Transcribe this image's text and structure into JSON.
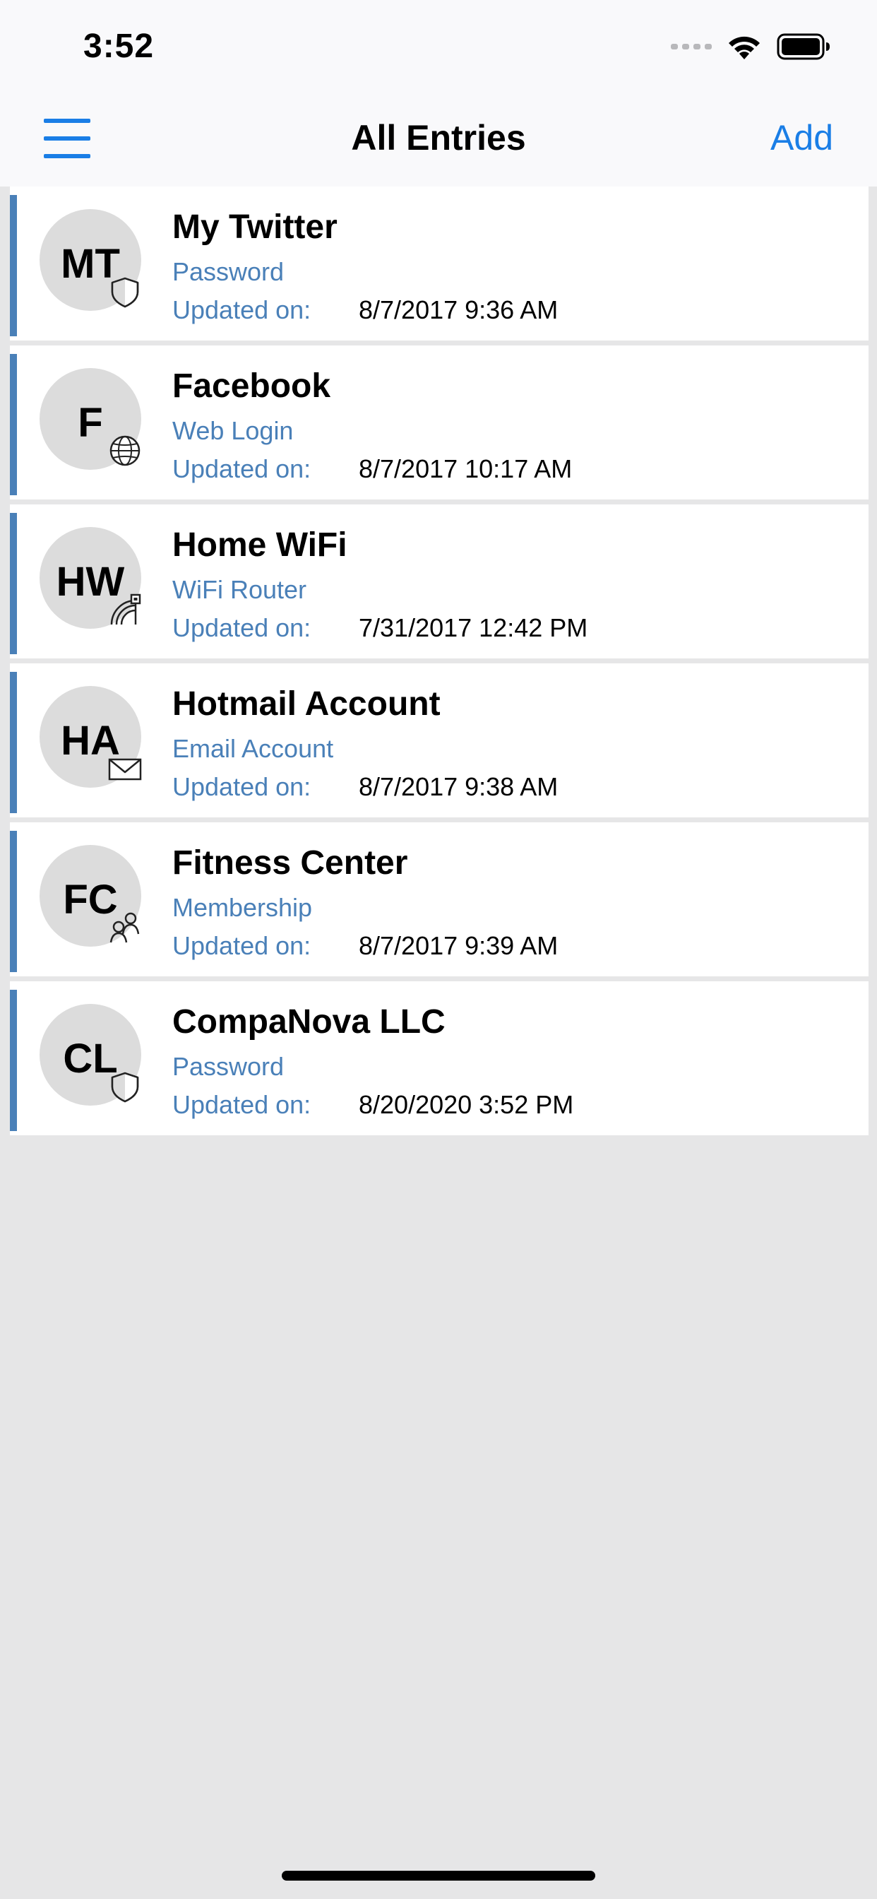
{
  "status_bar": {
    "time": "3:52"
  },
  "nav": {
    "title": "All Entries",
    "add_label": "Add"
  },
  "entries": [
    {
      "initials": "MT",
      "title": "My Twitter",
      "type": "Password",
      "updated_label": "Updated on:",
      "updated": "8/7/2017 9:36 AM",
      "icon": "shield-icon"
    },
    {
      "initials": "F",
      "title": "Facebook",
      "type": "Web Login",
      "updated_label": "Updated on:",
      "updated": "8/7/2017 10:17 AM",
      "icon": "globe-icon"
    },
    {
      "initials": "HW",
      "title": "Home WiFi",
      "type": "WiFi Router",
      "updated_label": "Updated on:",
      "updated": "7/31/2017 12:42 PM",
      "icon": "router-icon"
    },
    {
      "initials": "HA",
      "title": "Hotmail Account",
      "type": "Email Account",
      "updated_label": "Updated on:",
      "updated": "8/7/2017 9:38 AM",
      "icon": "envelope-icon"
    },
    {
      "initials": "FC",
      "title": "Fitness Center",
      "type": "Membership",
      "updated_label": "Updated on:",
      "updated": "8/7/2017 9:39 AM",
      "icon": "people-icon"
    },
    {
      "initials": "CL",
      "title": "CompaNova LLC",
      "type": "Password",
      "updated_label": "Updated on:",
      "updated": "8/20/2020 3:52 PM",
      "icon": "shield-icon"
    }
  ],
  "colors": {
    "accent_blue": "#1a7ee6",
    "entry_accent": "#4a80b8",
    "avatar_bg": "#dcdcdc",
    "list_bg": "#e6e6e7"
  }
}
